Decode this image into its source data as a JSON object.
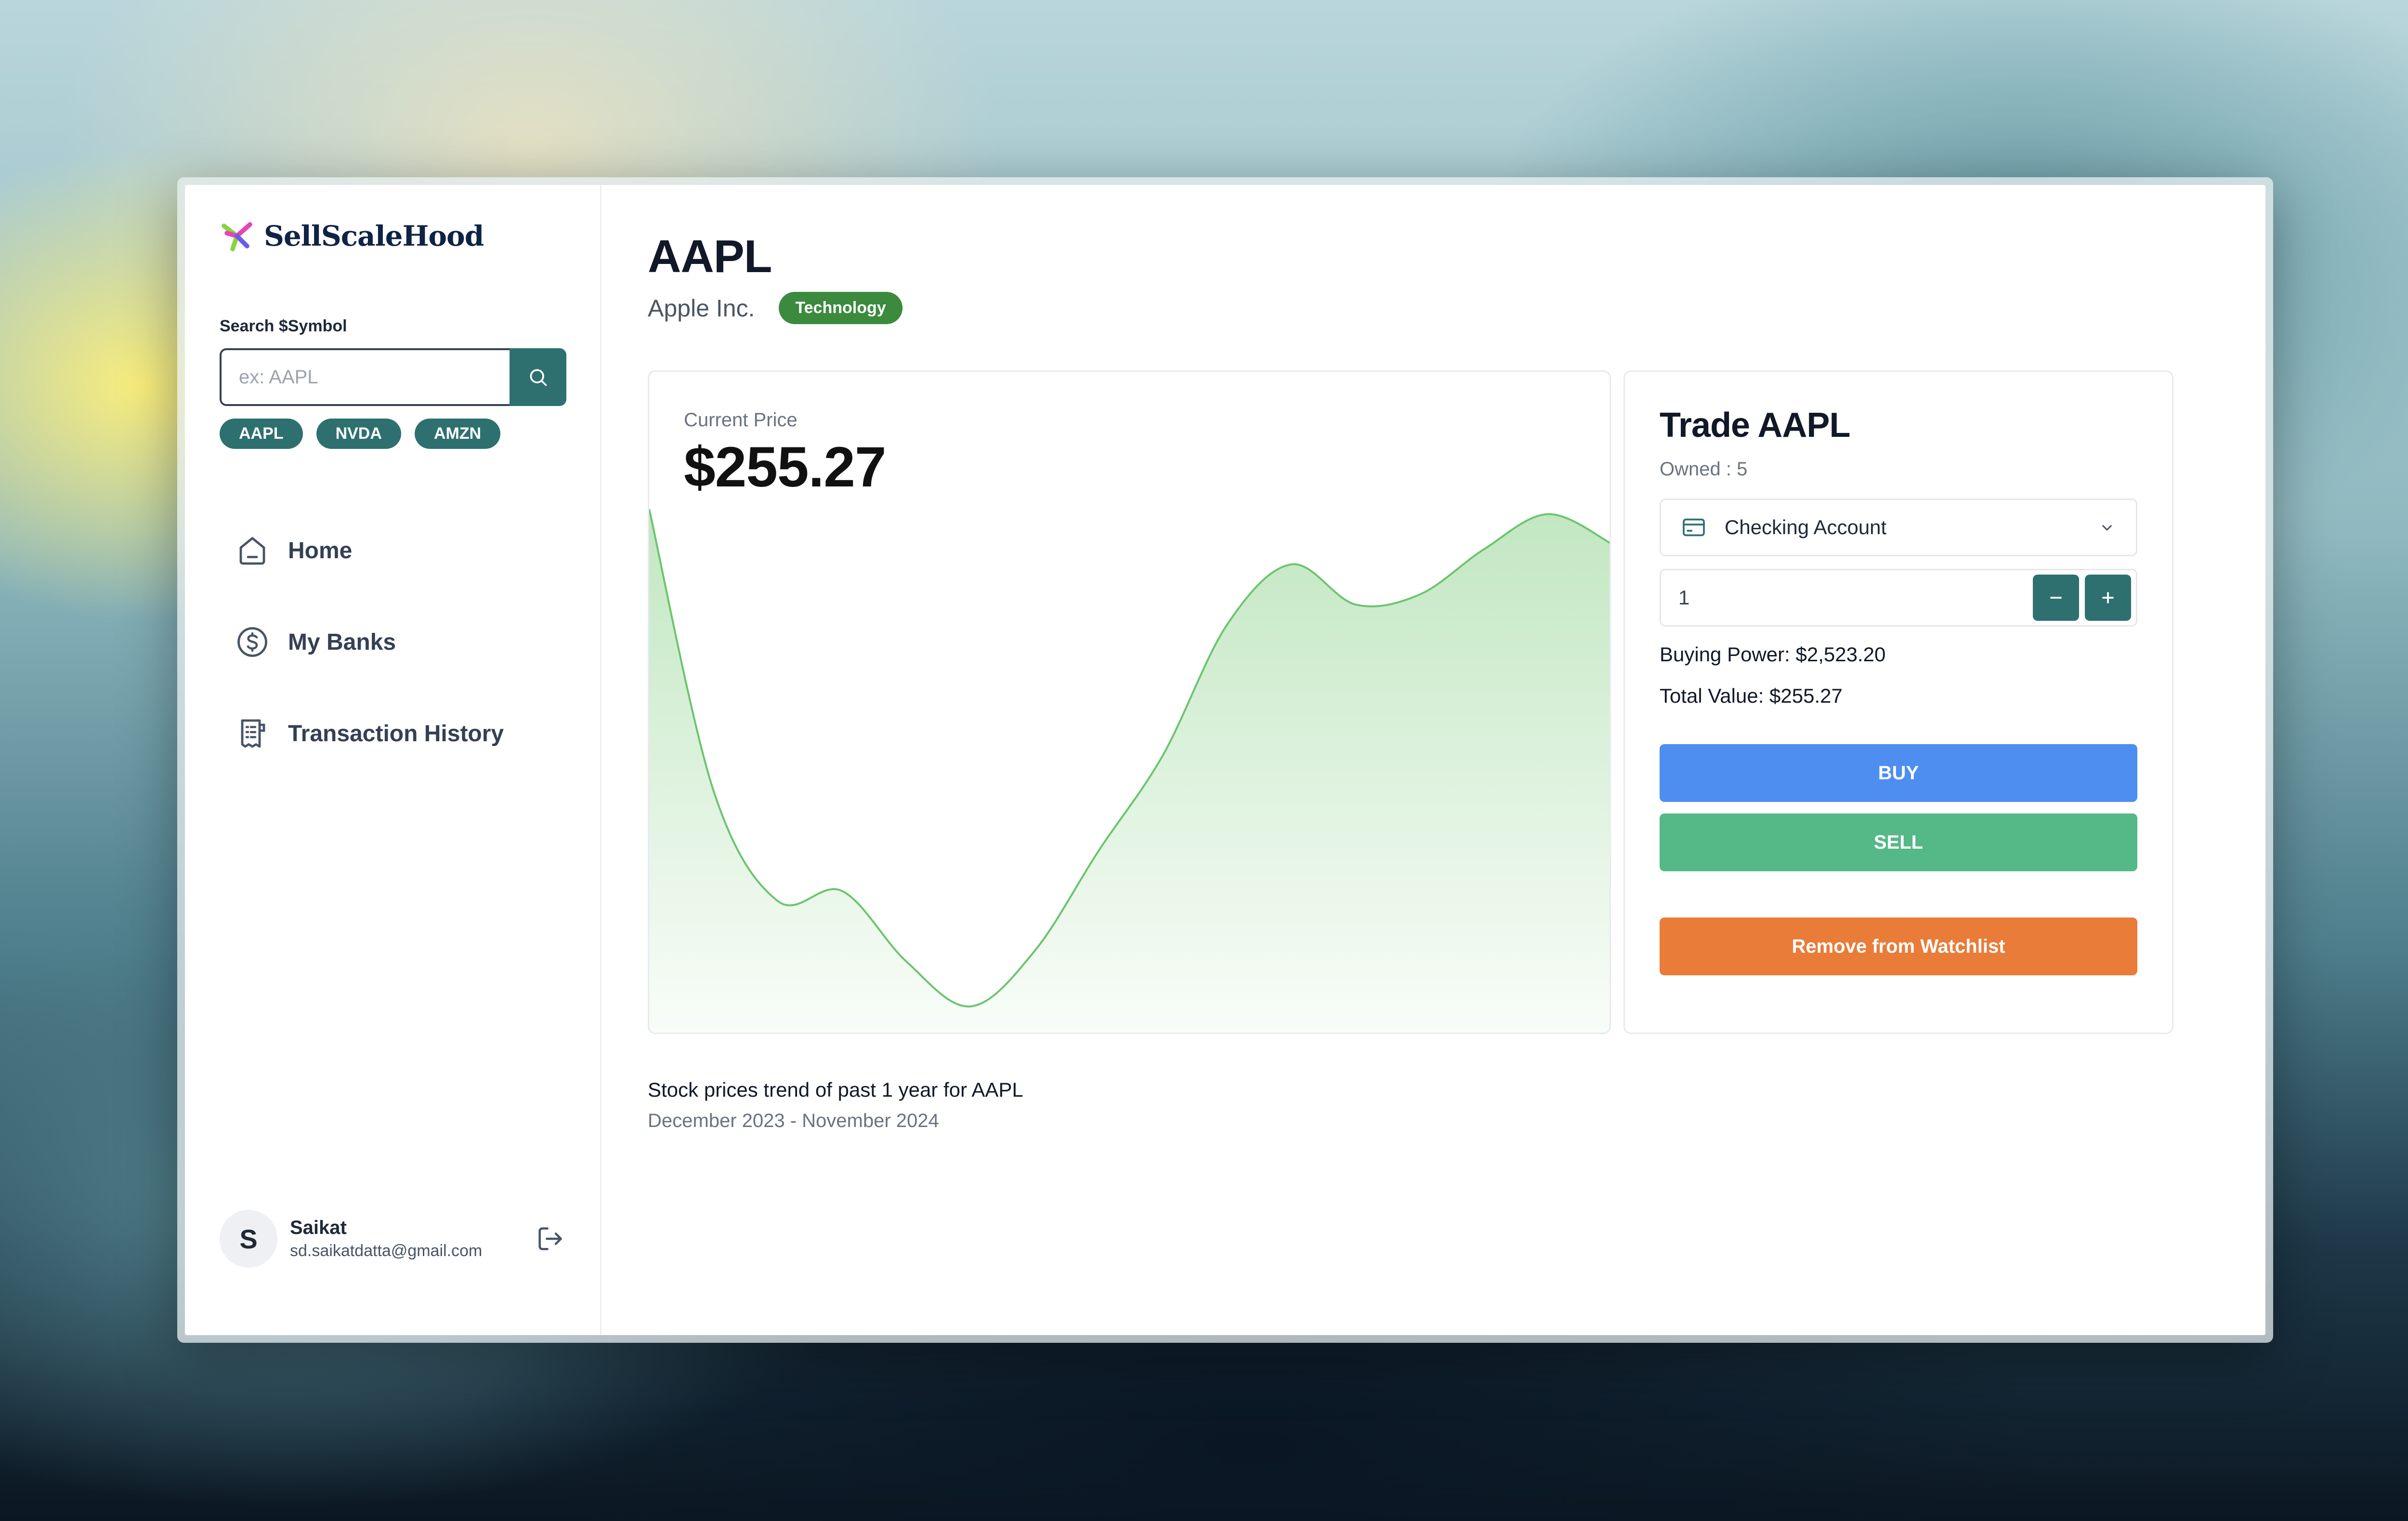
{
  "brand": {
    "name": "SellScaleHood"
  },
  "search": {
    "label": "Search $Symbol",
    "placeholder": "ex: AAPL",
    "quick_symbols": [
      "AAPL",
      "NVDA",
      "AMZN"
    ]
  },
  "nav": {
    "items": [
      {
        "label": "Home",
        "icon": "home-icon"
      },
      {
        "label": "My Banks",
        "icon": "dollar-circle-icon"
      },
      {
        "label": "Transaction History",
        "icon": "receipt-icon"
      }
    ]
  },
  "user": {
    "initial": "S",
    "name": "Saikat",
    "email": "sd.saikatdatta@gmail.com"
  },
  "stock": {
    "symbol": "AAPL",
    "company": "Apple Inc.",
    "sector": "Technology"
  },
  "price_card": {
    "label": "Current Price",
    "value": "$255.27"
  },
  "trade": {
    "title": "Trade AAPL",
    "owned": "Owned : 5",
    "account": "Checking Account",
    "quantity": "1",
    "buying_power": "Buying Power: $2,523.20",
    "total_value": "Total Value: $255.27",
    "buy_label": "BUY",
    "sell_label": "SELL",
    "watchlist_label": "Remove from Watchlist"
  },
  "caption": {
    "title": "Stock prices trend of past 1 year for AAPL",
    "range": "December 2023 - November 2024"
  },
  "colors": {
    "teal": "#2e7070",
    "sector_badge": "#3b8a3e",
    "buy": "#4d8ef0",
    "sell": "#55b887",
    "watchlist": "#e87c38",
    "chart_line": "#6cc46e"
  },
  "chart_data": {
    "type": "area",
    "title": "",
    "xlabel": "",
    "ylabel": "",
    "series": [
      {
        "values": [
          100,
          44,
          22,
          24,
          10,
          1,
          12,
          32,
          51,
          77,
          89,
          81,
          83,
          92,
          99,
          93
        ]
      }
    ],
    "grid": false,
    "legend": "none"
  }
}
